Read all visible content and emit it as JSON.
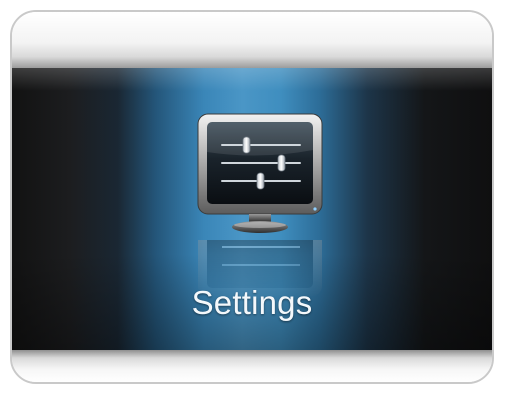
{
  "menu": {
    "selected_item": {
      "label": "Settings",
      "icon": "settings-monitor-sliders-icon"
    }
  },
  "colors": {
    "highlight_blue": "#4a96c6",
    "background_dark": "#121212",
    "label_text": "#f4f8fb"
  }
}
